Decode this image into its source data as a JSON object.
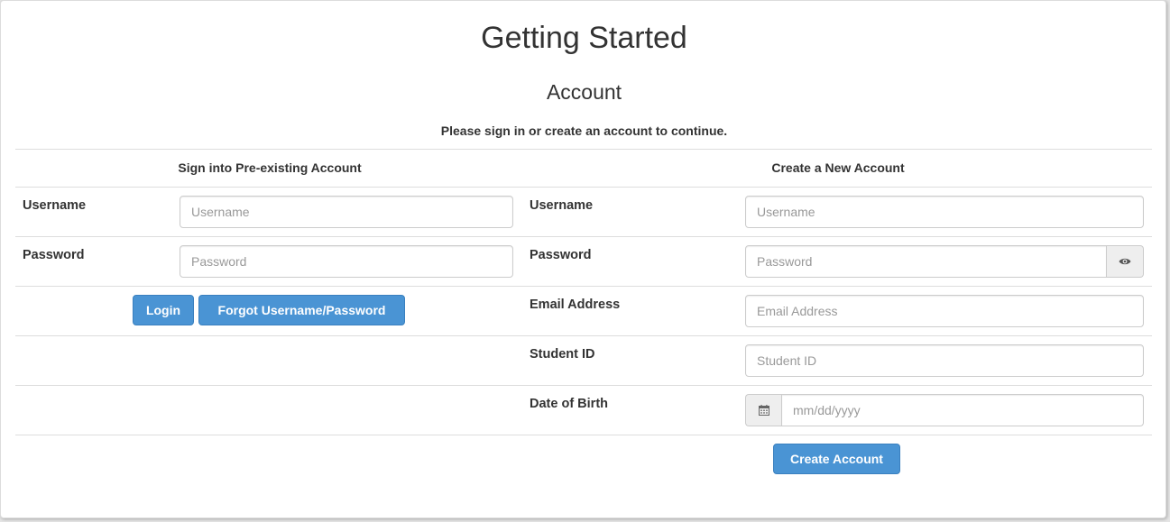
{
  "page": {
    "title": "Getting Started",
    "subtitle": "Account",
    "prompt": "Please sign in or create an account to continue."
  },
  "signin": {
    "heading": "Sign into Pre-existing Account",
    "username_label": "Username",
    "username_placeholder": "Username",
    "password_label": "Password",
    "password_placeholder": "Password",
    "login_label": "Login",
    "forgot_label": "Forgot Username/Password"
  },
  "create": {
    "heading": "Create a New Account",
    "username_label": "Username",
    "username_placeholder": "Username",
    "password_label": "Password",
    "password_placeholder": "Password",
    "email_label": "Email Address",
    "email_placeholder": "Email Address",
    "student_id_label": "Student ID",
    "student_id_placeholder": "Student ID",
    "dob_label": "Date of Birth",
    "dob_placeholder": "mm/dd/yyyy",
    "create_label": "Create Account"
  },
  "icons": {
    "show_password": "eye-icon",
    "date_picker": "calendar-icon"
  },
  "colors": {
    "primary_button": "#4a94d4",
    "divider": "#dddddd"
  }
}
